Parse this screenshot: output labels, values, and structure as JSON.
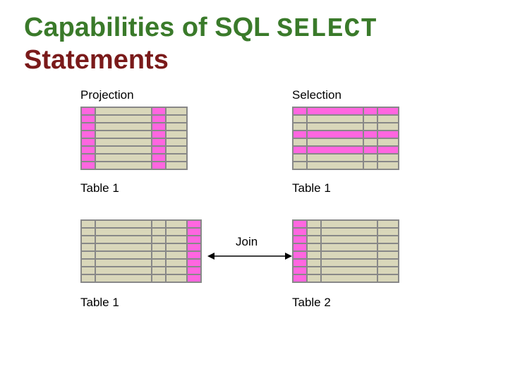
{
  "title": {
    "part1": "Capabilities of SQL ",
    "select_word": "SELECT",
    "part2": "Statements"
  },
  "labels": {
    "projection": "Projection",
    "selection": "Selection",
    "table1_a": "Table 1",
    "table1_b": "Table 1",
    "table1_c": "Table 1",
    "table2": "Table 2",
    "join": "Join"
  },
  "tables": {
    "projection": {
      "rows": 8,
      "cols": [
        20,
        80,
        20,
        30
      ],
      "highlight_cols": [
        0,
        2
      ]
    },
    "selection": {
      "rows": 8,
      "cols": [
        20,
        80,
        20,
        30
      ],
      "highlight_rows": [
        0,
        3,
        5
      ]
    },
    "join_left": {
      "rows": 8,
      "cols": [
        20,
        80,
        20,
        30,
        20
      ],
      "highlight_cols": [
        4
      ]
    },
    "join_right": {
      "rows": 8,
      "cols": [
        20,
        20,
        80,
        30
      ],
      "highlight_cols": [
        0
      ]
    }
  }
}
